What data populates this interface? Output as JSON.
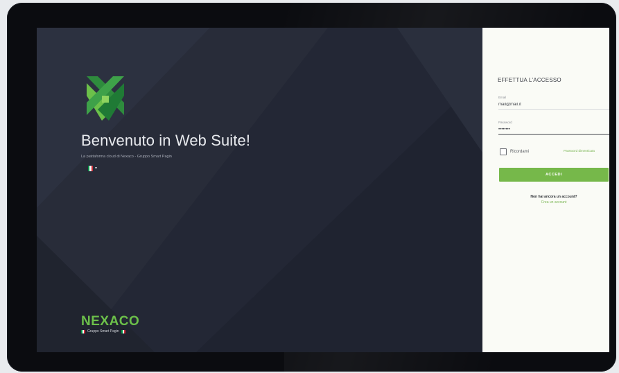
{
  "hero": {
    "welcome_title": "Benvenuto in Web Suite!",
    "subtitle": "La piattaforma cloud di Nexaco - Gruppo Smart Pagin",
    "language": {
      "flag_colors": [
        "#009246",
        "#ffffff",
        "#ce2b37"
      ],
      "caret": "▾"
    }
  },
  "brand": {
    "name": "NEXACO",
    "tagline": "Gruppo Smart Pagin",
    "primary_color": "#6cc04a"
  },
  "login": {
    "title": "EFFETTUA L'ACCESSO",
    "email": {
      "label": "Email",
      "value": "mail@mail.it"
    },
    "password": {
      "label": "Password",
      "value": "••••••••"
    },
    "remember_label": "Ricordami",
    "forgot_password": "Password dimenticata",
    "submit_label": "ACCEDI",
    "no_account_text": "Non hai ancora un account?",
    "create_account_link": "Crea un account",
    "accent_color": "#76b84a"
  }
}
